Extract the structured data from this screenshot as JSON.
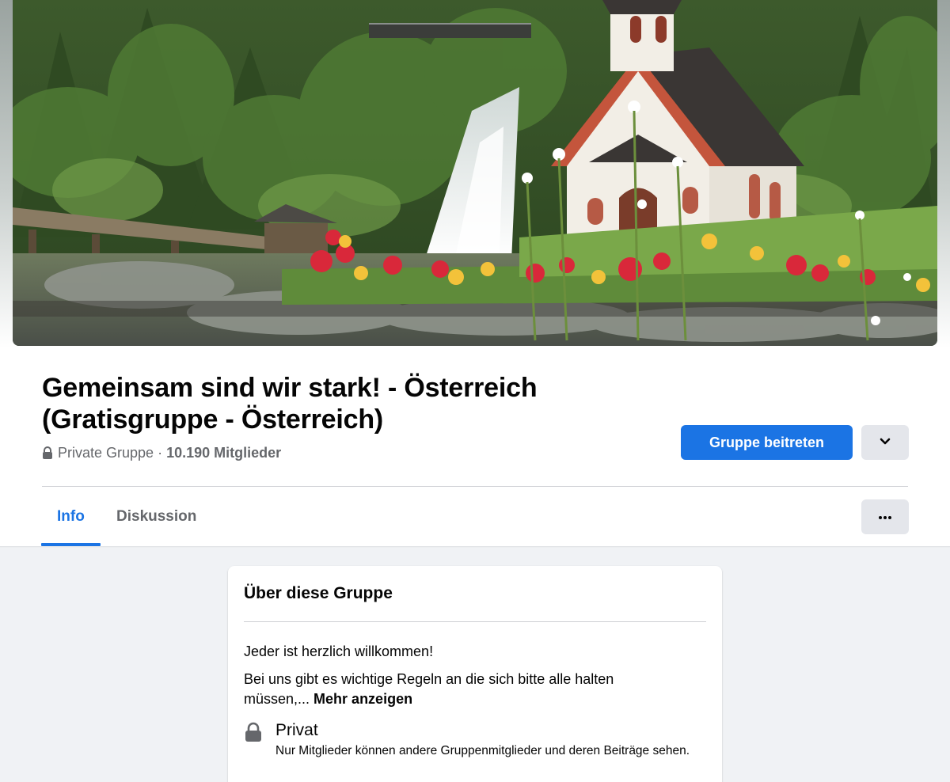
{
  "group": {
    "name": "Gemeinsam sind wir stark! - Österreich (Gratisgruppe - Österreich)",
    "privacy": "Private Gruppe",
    "separator": " · ",
    "members": "10.190 Mitglieder"
  },
  "actions": {
    "join_label": "Gruppe beitreten",
    "dropdown_icon": "chevron-down-icon",
    "more_icon": "ellipsis-icon"
  },
  "tabs": [
    {
      "label": "Info",
      "active": true
    },
    {
      "label": "Diskussion",
      "active": false
    }
  ],
  "about": {
    "title": "Über diese Gruppe",
    "welcome": "Jeder ist herzlich willkommen!",
    "description": "Bei uns gibt es wichtige Regeln an die sich bitte alle halten müssen,...",
    "see_more": "Mehr anzeigen",
    "privacy_title": "Privat",
    "privacy_desc": "Nur Mitglieder können andere Gruppenmitglieder und deren Beiträge sehen."
  },
  "colors": {
    "accent": "#1b74e4",
    "secondary_text": "#65676b",
    "background": "#f0f2f5",
    "button_gray": "#e4e6eb"
  }
}
